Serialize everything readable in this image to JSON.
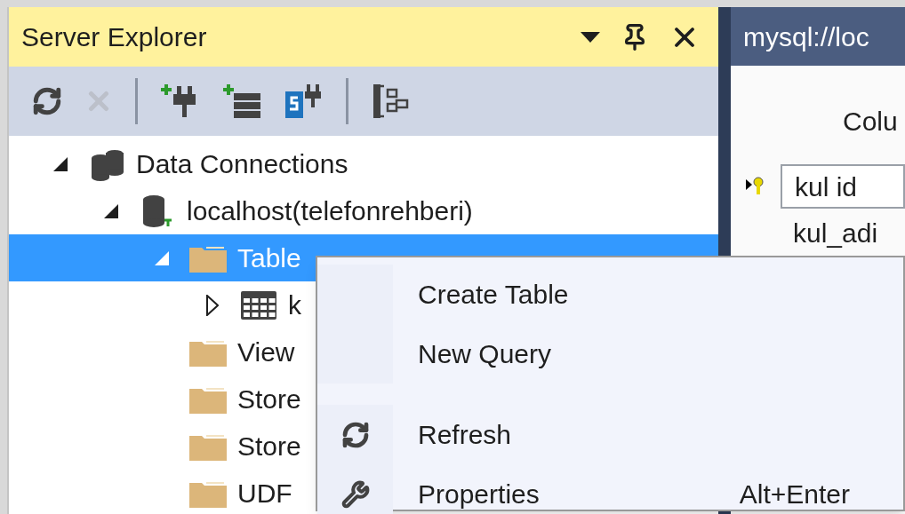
{
  "panel": {
    "title": "Server Explorer"
  },
  "toolbar": [
    {
      "kind": "refresh",
      "disabled": false
    },
    {
      "kind": "delete",
      "disabled": true
    },
    {
      "kind": "separator"
    },
    {
      "kind": "add-connection",
      "disabled": false
    },
    {
      "kind": "add-server",
      "disabled": false
    },
    {
      "kind": "sharepoint",
      "disabled": false
    },
    {
      "kind": "separator"
    },
    {
      "kind": "schema",
      "disabled": false
    }
  ],
  "tree": [
    {
      "label": "Data Connections",
      "kind": "connections",
      "expanded": true,
      "selected": false,
      "children": [
        {
          "label": "localhost(telefonrehberi)",
          "kind": "database",
          "expanded": true,
          "selected": false,
          "children": [
            {
              "label": "Table",
              "kind": "folder",
              "expanded": true,
              "selected": true,
              "children": [
                {
                  "label": "k",
                  "kind": "table",
                  "expanded": false,
                  "selected": false
                }
              ]
            },
            {
              "label": "View",
              "kind": "folder",
              "selected": false
            },
            {
              "label": "Store",
              "kind": "folder",
              "selected": false
            },
            {
              "label": "Store",
              "kind": "folder",
              "selected": false
            },
            {
              "label": "UDF",
              "kind": "folder",
              "selected": false
            }
          ]
        }
      ]
    }
  ],
  "editor": {
    "tab": "mysql://loc",
    "heading": "Colu",
    "rows": [
      {
        "name": "kul id",
        "primary_key": true
      },
      {
        "name": "kul_adi",
        "primary_key": false
      }
    ]
  },
  "context_menu": [
    {
      "kind": "item",
      "label": "Create Table"
    },
    {
      "kind": "item",
      "label": "New Query"
    },
    {
      "kind": "separator"
    },
    {
      "kind": "refresh",
      "label": "Refresh"
    },
    {
      "kind": "properties",
      "label": "Properties",
      "shortcut": "Alt+Enter"
    }
  ]
}
